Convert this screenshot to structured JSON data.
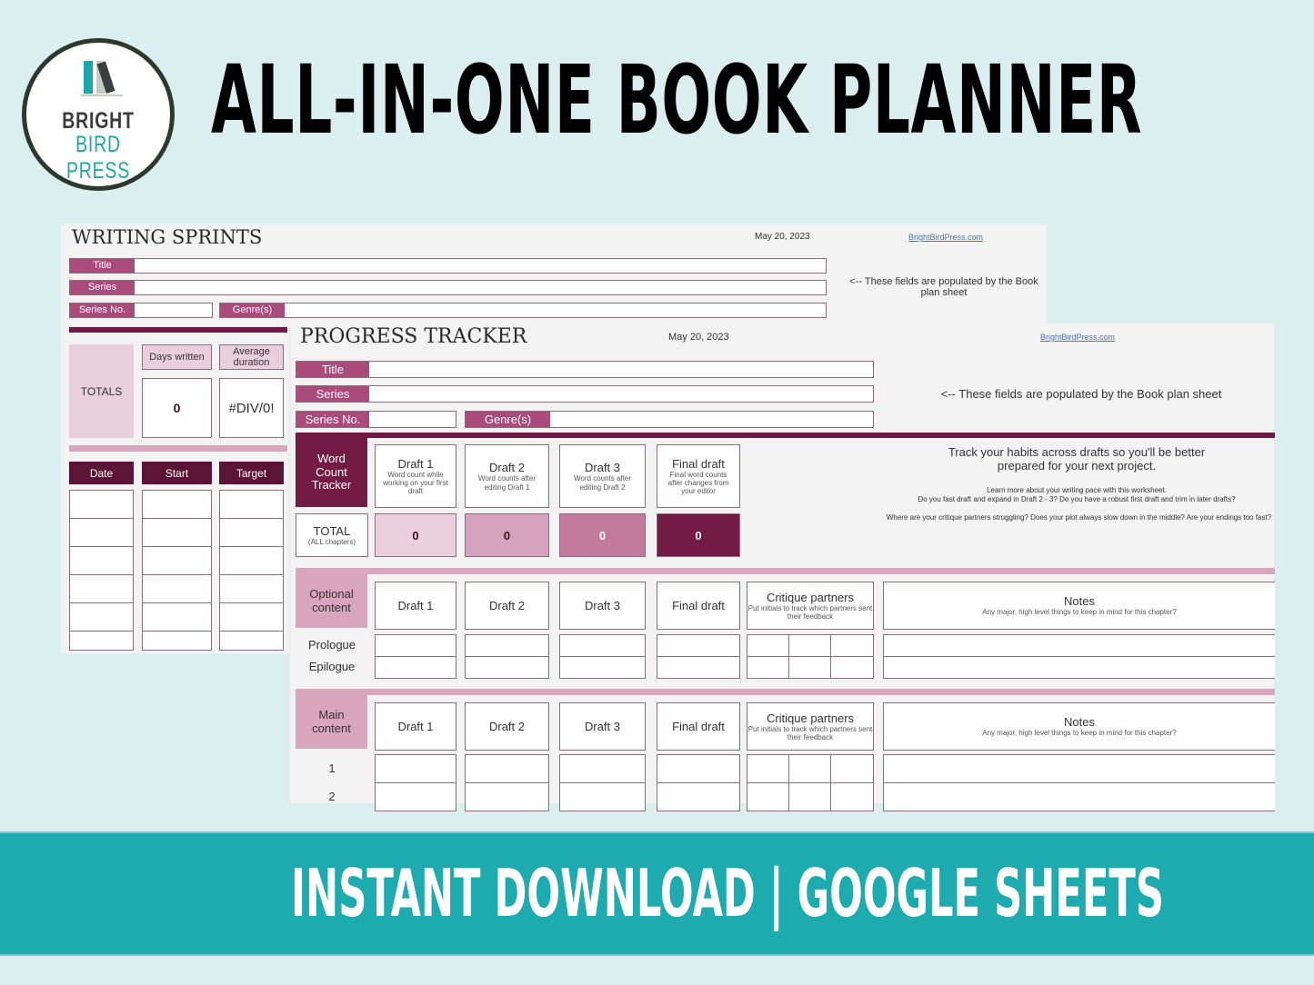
{
  "logo": {
    "line1": "BRIGHT",
    "line2": "BIRD PRESS"
  },
  "headline": "ALL-IN-ONE BOOK PLANNER",
  "writing_sprints": {
    "title": "WRITING SPRINTS",
    "date": "May 20, 2023",
    "link": "BrightBirdPress.com",
    "fields": {
      "title": "Title",
      "series": "Series",
      "series_no": "Series No.",
      "genres": "Genre(s)"
    },
    "populated_note": "<-- These fields are populated by the Book plan sheet",
    "totals_label": "TOTALS",
    "days_written_label": "Days written",
    "average_duration_label": "Average duration",
    "days_written_value": "0",
    "average_duration_value": "#DIV/0!",
    "columns": [
      "Date",
      "Start",
      "Target"
    ]
  },
  "progress_tracker": {
    "title": "PROGRESS TRACKER",
    "date": "May 20, 2023",
    "link": "BrightBirdPress.com",
    "fields": {
      "title": "Title",
      "series": "Series",
      "series_no": "Series No.",
      "genres": "Genre(s)"
    },
    "populated_note": "<-- These fields are populated by the Book plan sheet",
    "word_count_tracker": "Word Count Tracker",
    "drafts": [
      {
        "name": "Draft 1",
        "desc": "Word count while working on your first draft",
        "total": "0",
        "color": "#ebcfdc"
      },
      {
        "name": "Draft 2",
        "desc": "Word counts after editing Draft 1",
        "total": "0",
        "color": "#d5a3bd"
      },
      {
        "name": "Draft 3",
        "desc": "Word counts after editing Draft 2",
        "total": "0",
        "color": "#c37a9d"
      },
      {
        "name": "Final draft",
        "desc": "Final word counts after changes from your editor",
        "total": "0",
        "color": "#731a45"
      }
    ],
    "total_label": "TOTAL",
    "total_sub": "(ALL chapters)",
    "habits_heading": "Track your habits across drafts so you'll be better prepared for your next project.",
    "habits_p1": "Learn more about your writing pace with this worksheet.",
    "habits_p2": "Do you fast draft and expand in Draft 2 - 3? Do you have a robust first draft and trim in later drafts?",
    "habits_p3": "Where are your critique partners struggling? Does your plot always slow down in the middle? Are your endings too fast?",
    "optional": {
      "label": "Optional content",
      "columns": [
        "Draft 1",
        "Draft 2",
        "Draft 3",
        "Final draft"
      ],
      "critique_title": "Critique partners",
      "critique_sub": "Put initials to track which partners sent their feedback",
      "notes_title": "Notes",
      "notes_sub": "Any major, high level things to keep in mind for this chapter?",
      "rows": [
        "Prologue",
        "Epilogue"
      ]
    },
    "main": {
      "label": "Main content",
      "columns": [
        "Draft 1",
        "Draft 2",
        "Draft 3",
        "Final draft"
      ],
      "critique_title": "Critique partners",
      "critique_sub": "Put initials to track which partners sent their feedback",
      "notes_title": "Notes",
      "notes_sub": "Any major, high level things to keep in mind for this chapter?",
      "rows": [
        "1",
        "2"
      ]
    }
  },
  "banner": "INSTANT DOWNLOAD  |  GOOGLE SHEETS"
}
